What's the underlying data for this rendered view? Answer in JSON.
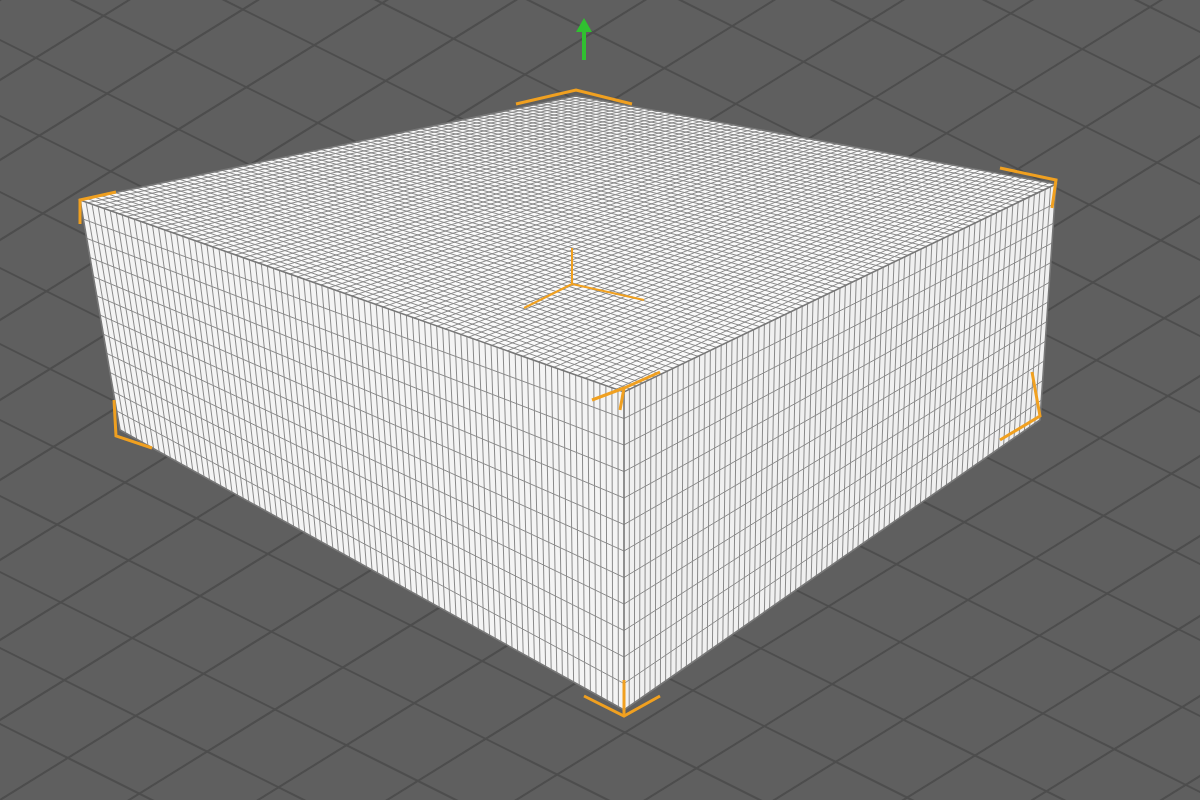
{
  "viewport": {
    "object": {
      "kind": "cube",
      "selected": true
    }
  }
}
